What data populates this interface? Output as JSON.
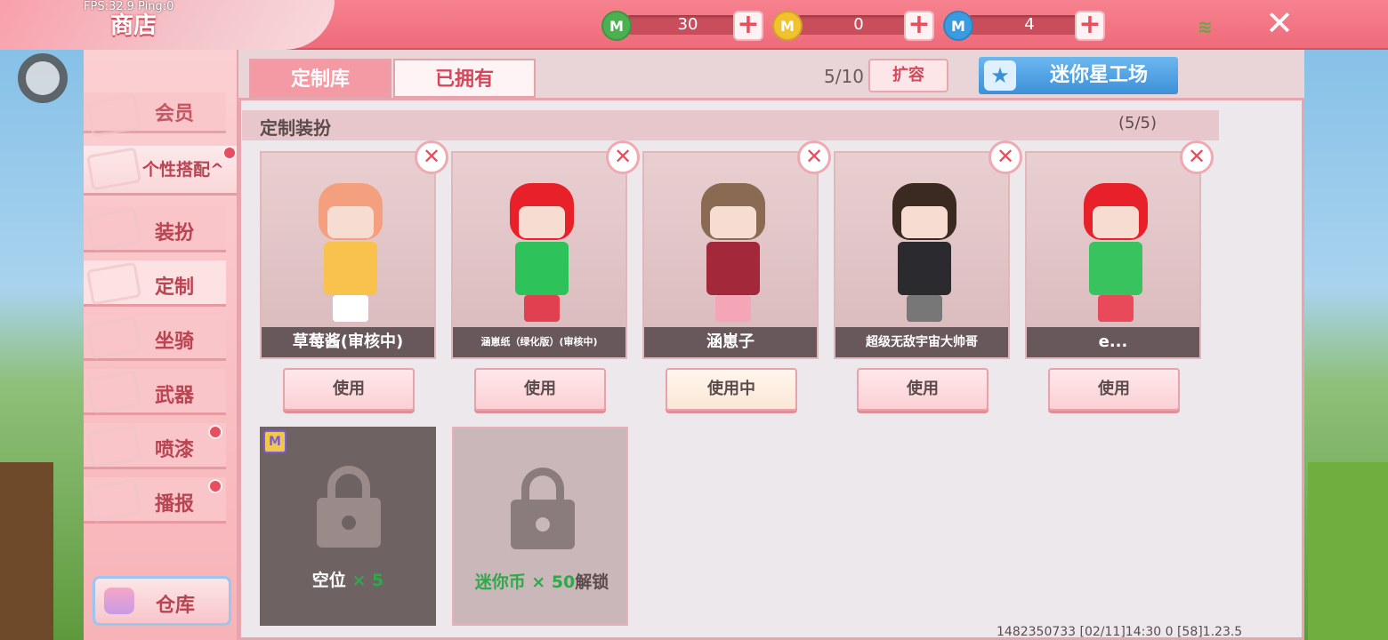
{
  "debug": {
    "fps": "FPS:32.9  Ping:0"
  },
  "header": {
    "title": "商店"
  },
  "currencies": [
    {
      "name": "green-coin",
      "value": "30",
      "color": "#4caf50"
    },
    {
      "name": "gold-coin",
      "value": "0",
      "color": "#f2c12e"
    },
    {
      "name": "blue-coin",
      "value": "4",
      "color": "#3a9be0"
    }
  ],
  "sidebar": {
    "items": [
      {
        "label": "会员"
      },
      {
        "label": "个性搭配"
      },
      {
        "label": "装扮"
      },
      {
        "label": "定制"
      },
      {
        "label": "坐骑"
      },
      {
        "label": "武器"
      },
      {
        "label": "喷漆"
      },
      {
        "label": "播报"
      }
    ],
    "header_arrow": "^",
    "warehouse": "仓库"
  },
  "tabs": {
    "library": "定制库",
    "owned": "已拥有"
  },
  "capacity": "5/10",
  "expand_label": "扩容",
  "studio_label": "迷你星工场",
  "section": {
    "title": "定制装扮",
    "count": "(5/5)"
  },
  "cards": [
    {
      "name": "草莓酱(审核中)",
      "button": "使用",
      "hair": "#f4a07f",
      "outfit": "#f9c24d"
    },
    {
      "name": "涵崽纸（绿化版）(审核中)",
      "button": "使用",
      "hair": "#e8202a",
      "outfit": "#2ec25a"
    },
    {
      "name": "涵崽子",
      "button": "使用中",
      "hair": "#8a6a52",
      "outfit": "#f4a6b6"
    },
    {
      "name": "超级无敌宇宙大帅哥",
      "button": "使用",
      "hair": "#3a2a22",
      "outfit": "#2b2a2e"
    },
    {
      "name": "e...",
      "button": "使用",
      "hair": "#e8202a",
      "outfit": "#39c35e"
    }
  ],
  "slots": [
    {
      "label": "空位",
      "suffix": "× 5",
      "badge": "M"
    },
    {
      "label": "迷你币 × 50",
      "suffix": "解锁"
    }
  ],
  "footer": "1482350733   [02/11]14:30 0    [58]1.23.5"
}
